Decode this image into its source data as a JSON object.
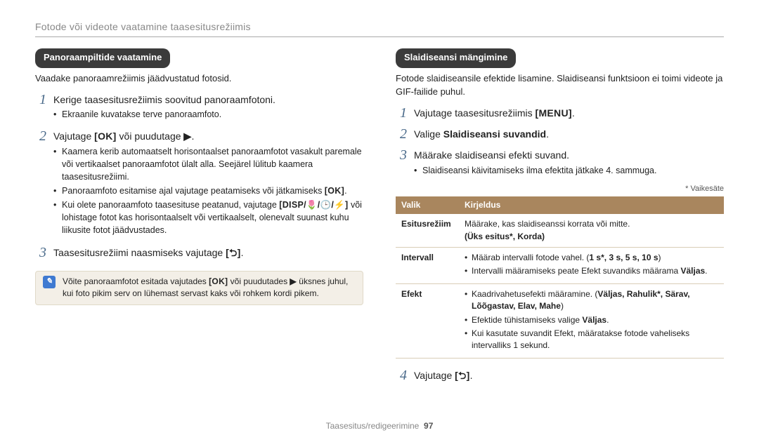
{
  "page_header": "Fotode või videote vaatamine taasesitusrežiimis",
  "footer_text": "Taasesitus/redigeerimine",
  "footer_page": "97",
  "left": {
    "section_title": "Panoraampiltide vaatamine",
    "intro": "Vaadake panoraamrežiimis jäädvustatud fotosid.",
    "step1_main": "Kerige taasesitusrežiimis soovitud panoraamfotoni.",
    "step1_bullet1": "Ekraanile kuvatakse terve panoraamfoto.",
    "step2_prefix": "Vajutage ",
    "step2_bracket_ok": "[OK]",
    "step2_mid": " või puudutage ",
    "step2_play_icon": "▶",
    "step2_suffix": ".",
    "step2_bullet1": "Kaamera kerib automaatselt horisontaalset panoraamfotot vasakult paremale või vertikaalset panoraamfotot ülalt alla. Seejärel lülitub kaamera taasesitusrežiimi.",
    "step2_b2_pre": "Panoraamfoto esitamise ajal vajutage peatamiseks või jätkamiseks ",
    "step2_b2_ok": "[OK]",
    "step2_b2_post": ".",
    "step2_b3_pre": "Kui olete panoraamfoto taasesituse peatanud, vajutage ",
    "step2_b3_icons": "[DISP/🌷/🕒/⚡]",
    "step2_b3_post": " või lohistage fotot kas horisontaalselt või vertikaalselt, olenevalt suunast kuhu liikusite fotot jäädvustades.",
    "step3_pre": "Taasesitusrežiimi naasmiseks vajutage ",
    "step3_icon": "[⮌]",
    "step3_post": ".",
    "note_pre": "Võite panoraamfotot esitada vajutades ",
    "note_ok": "[OK]",
    "note_mid": " või puudutades ",
    "note_play": "▶",
    "note_post": " üksnes juhul, kui foto pikim serv on lühemast servast kaks või rohkem kordi pikem."
  },
  "right": {
    "section_title": "Slaidiseansi mängimine",
    "intro": "Fotode slaidiseansile efektide lisamine. Slaidiseansi funktsioon ei toimi videote ja GIF-failide puhul.",
    "step1_pre": "Vajutage taasesitusrežiimis ",
    "step1_icon": "[MENU]",
    "step1_post": ".",
    "step2_pre": "Valige ",
    "step2_bold": "Slaidiseansi suvandid",
    "step2_post": ".",
    "step3_main": "Määrake slaidiseansi efekti suvand.",
    "step3_bullet1": "Slaidiseansi käivitamiseks ilma efektita jätkake 4. sammuga.",
    "default_note": "* Vaikesäte",
    "th1": "Valik",
    "th2": "Kirjeldus",
    "row1_label": "Esitusrežiim",
    "row1_desc_line1": "Määrake, kas slaidiseanssi korrata või mitte.",
    "row1_desc_options": "(Üks esitus*, Korda)",
    "row2_label": "Intervall",
    "row2_b1_pre": "Määrab intervalli fotode vahel. (",
    "row2_b1_opts": "1 s*, 3 s, 5 s, 10 s",
    "row2_b1_post": ")",
    "row2_b2_pre": "Intervalli määramiseks peate Efekt suvandiks määrama ",
    "row2_b2_bold": "Väljas",
    "row2_b2_post": ".",
    "row3_label": "Efekt",
    "row3_b1_pre": "Kaadrivahetusefekti määramine. (",
    "row3_b1_opts": "Väljas, Rahulik*, Särav, Lõõgastav, Elav, Mahe",
    "row3_b1_post": ")",
    "row3_b2_pre": "Efektide tühistamiseks valige ",
    "row3_b2_bold": "Väljas",
    "row3_b2_post": ".",
    "row3_b3": "Kui kasutate suvandit Efekt, määratakse fotode vaheliseks intervalliks 1 sekund.",
    "step4_pre": "Vajutage ",
    "step4_icon": "[⮌]",
    "step4_post": "."
  }
}
